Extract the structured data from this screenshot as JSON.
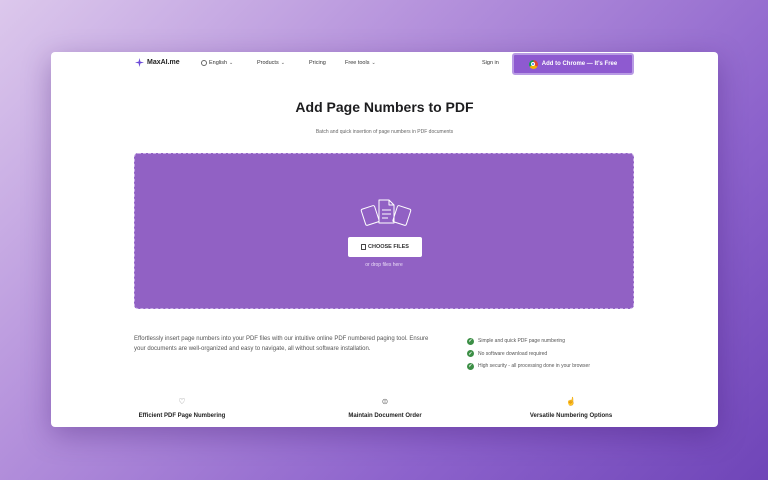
{
  "header": {
    "brand": "MaxAI.me",
    "language": "English",
    "products": "Products",
    "pricing": "Pricing",
    "free_tools": "Free tools",
    "sign_in": "Sign in",
    "cta": "Add to Chrome — It's Free"
  },
  "hero": {
    "title": "Add Page Numbers to PDF",
    "subtitle": "Batch and quick insertion of page numbers in PDF documents"
  },
  "upload": {
    "button": "CHOOSE FILES",
    "hint": "or drop files here"
  },
  "description": "Effortlessly insert page numbers into your PDF files with our intuitive online PDF numbered paging tool. Ensure your documents are well-organized and easy to navigate, all without software installation.",
  "checks": [
    "Simple and quick PDF page numbering",
    "No software download required",
    "High security - all processing done in your browser"
  ],
  "features": [
    {
      "icon": "lightbulb-icon",
      "label": "Efficient PDF Page Numbering"
    },
    {
      "icon": "order-icon",
      "label": "Maintain Document Order"
    },
    {
      "icon": "thumbs-up-icon",
      "label": "Versatile Numbering Options"
    }
  ],
  "colors": {
    "accent": "#8e5ad0",
    "drop_bg": "#9161c4",
    "check": "#3c8f46"
  }
}
